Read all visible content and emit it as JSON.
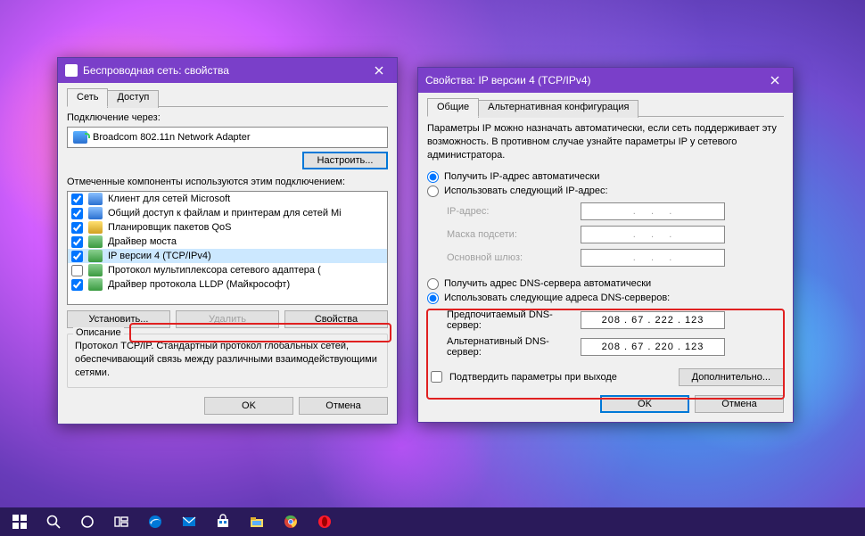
{
  "common": {
    "ok": "OK",
    "cancel": "Отмена"
  },
  "win1": {
    "title": "Беспроводная сеть: свойства",
    "tabs": [
      "Сеть",
      "Доступ"
    ],
    "connect_using": "Подключение через:",
    "adapter": "Broadcom 802.11n Network Adapter",
    "configure_btn": "Настроить...",
    "components_label": "Отмеченные компоненты используются этим подключением:",
    "items": [
      "Клиент для сетей Microsoft",
      "Общий доступ к файлам и принтерам для сетей Mi",
      "Планировщик пакетов QoS",
      "Драйвер моста",
      "IP версии 4 (TCP/IPv4)",
      "Протокол мультиплексора сетевого адаптера (",
      "Драйвер протокола LLDP (Майкрософт)"
    ],
    "install_btn": "Установить...",
    "uninstall_btn": "Удалить",
    "properties_btn": "Свойства",
    "desc_title": "Описание",
    "desc_text": "Протокол TCP/IP. Стандартный протокол глобальных сетей, обеспечивающий связь между различными взаимодействующими сетями."
  },
  "win2": {
    "title": "Свойства: IP версии 4 (TCP/IPv4)",
    "tabs": [
      "Общие",
      "Альтернативная конфигурация"
    ],
    "intro": "Параметры IP можно назначать автоматически, если сеть поддерживает эту возможность. В противном случае узнайте параметры IP у сетевого администратора.",
    "ip_auto": "Получить IP-адрес автоматически",
    "ip_manual": "Использовать следующий IP-адрес:",
    "ip_addr_lbl": "IP-адрес:",
    "mask_lbl": "Маска подсети:",
    "gw_lbl": "Основной шлюз:",
    "dns_auto": "Получить адрес DNS-сервера автоматически",
    "dns_manual": "Использовать следующие адреса DNS-серверов:",
    "dns_pref_lbl": "Предпочитаемый DNS-сервер:",
    "dns_pref_val": "208 . 67 . 222 . 123",
    "dns_alt_lbl": "Альтернативный DNS-сервер:",
    "dns_alt_val": "208 . 67 . 220 . 123",
    "validate_lbl": "Подтвердить параметры при выходе",
    "advanced_btn": "Дополнительно..."
  }
}
